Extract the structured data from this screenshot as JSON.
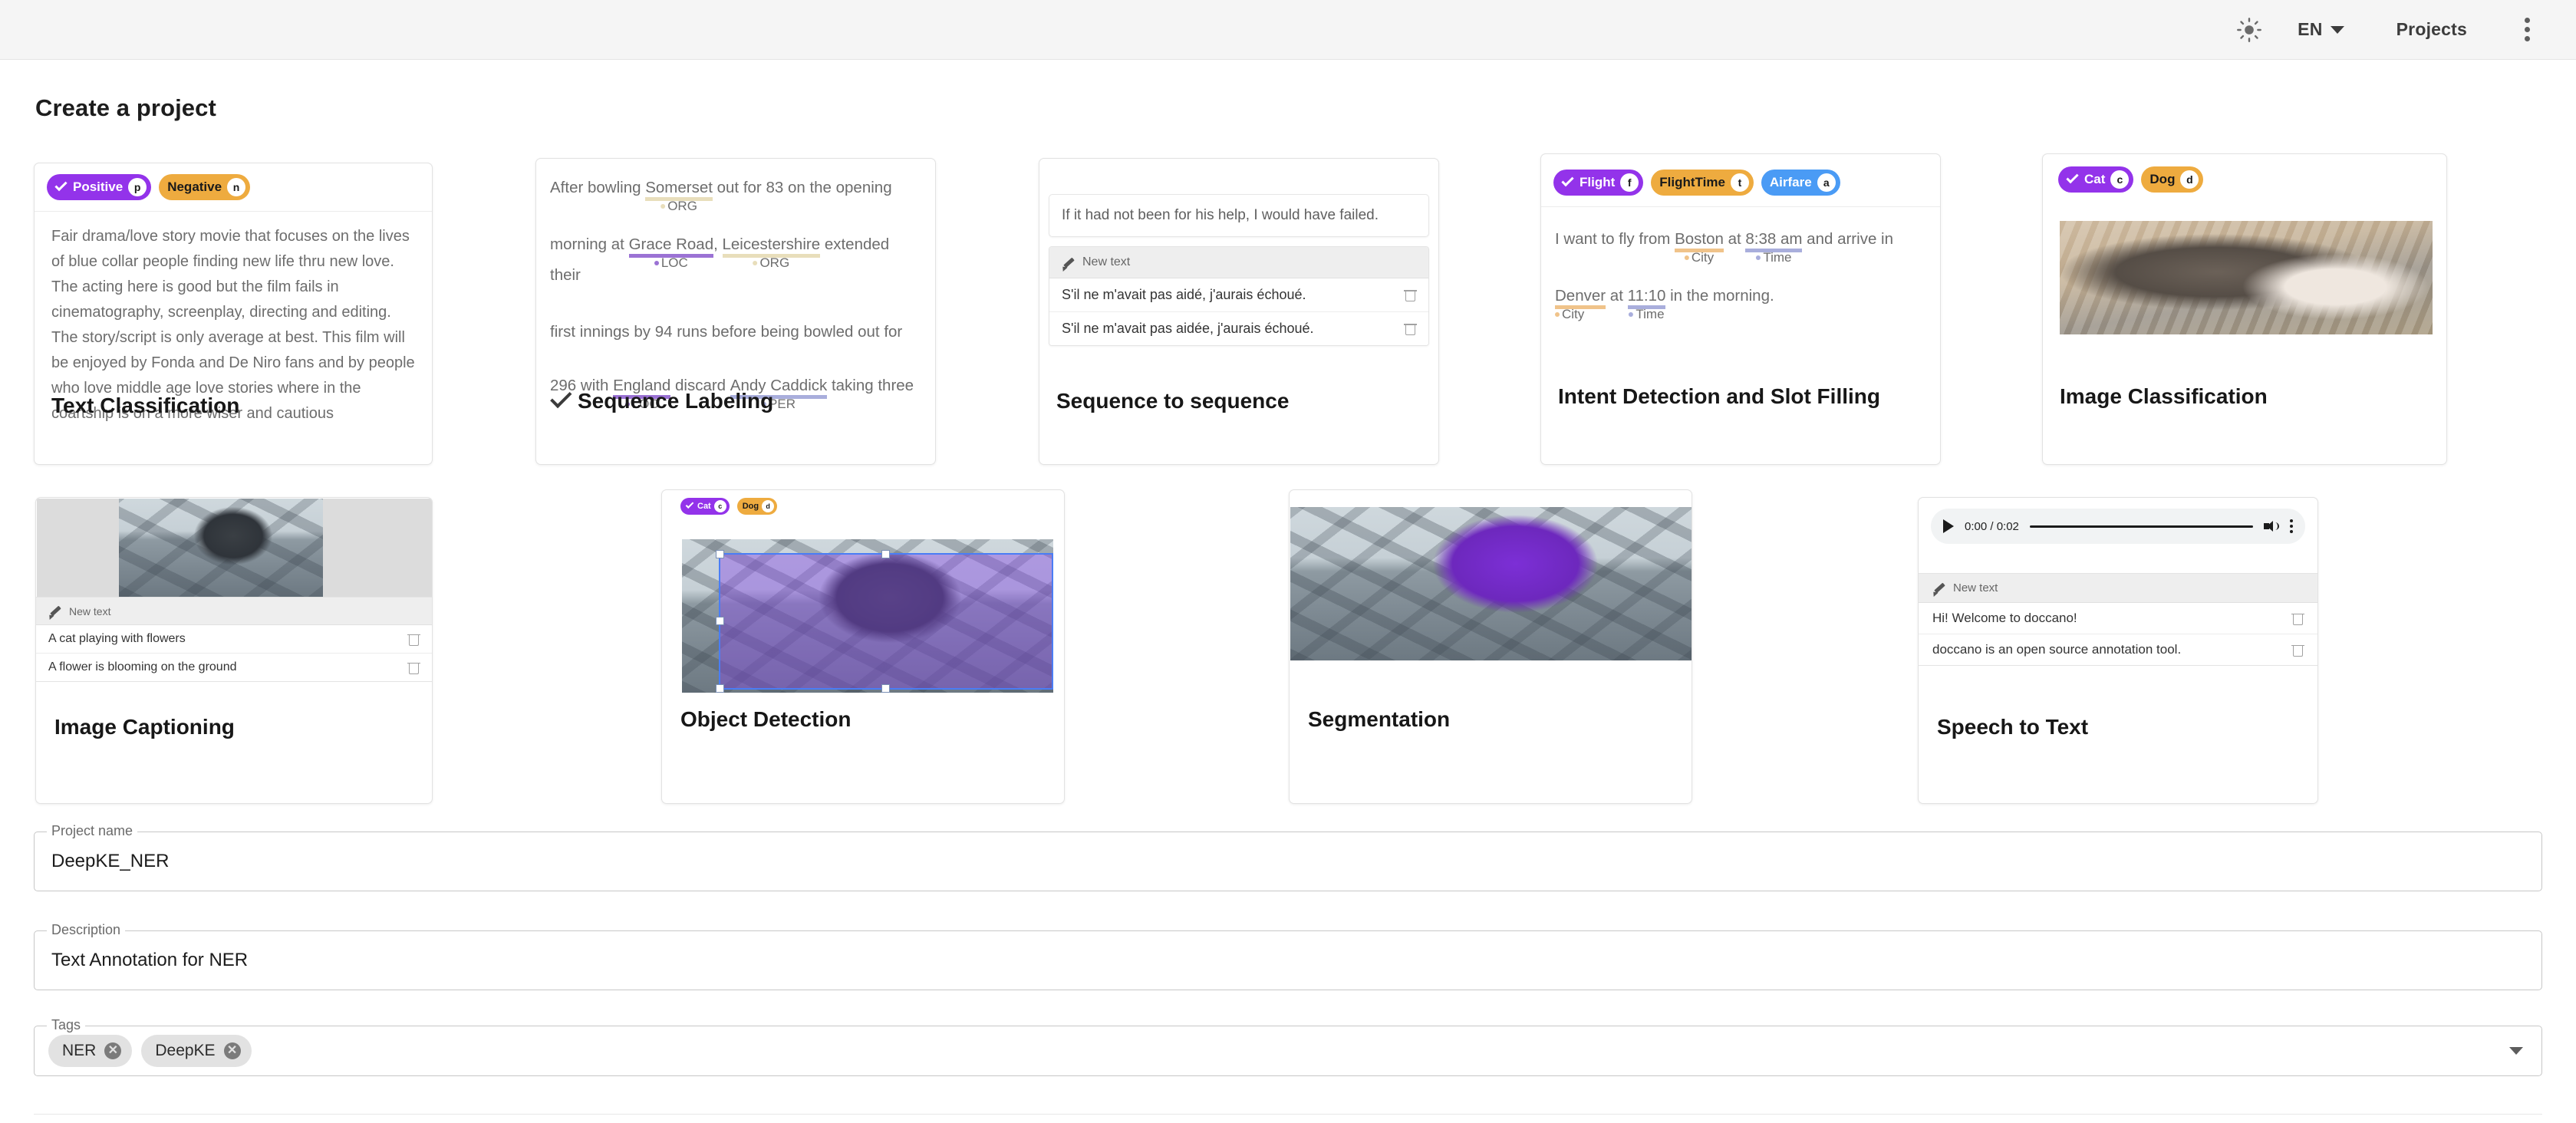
{
  "topbar": {
    "theme_icon": "sun-icon",
    "language": "EN",
    "projects_label": "Projects",
    "menu_icon": "kebab-menu-icon"
  },
  "page": {
    "title": "Create a project"
  },
  "project_types": [
    {
      "id": "text-classification",
      "title": "Text Classification",
      "selected": false,
      "labels": [
        {
          "text": "Positive",
          "key": "p",
          "color": "#9333ea",
          "checked": true
        },
        {
          "text": "Negative",
          "key": "n",
          "color": "#eeab3f",
          "checked": false
        }
      ],
      "body": "Fair drama/love story movie that focuses on the lives of blue collar people finding new life thru new love. The acting here is good but the film fails in cinematography, screenplay, directing and editing. The story/script is only average at best. This film will be enjoyed by Fonda and De Niro fans and by people who love middle age love stories where in the coartship is on a more wiser and cautious"
    },
    {
      "id": "sequence-labeling",
      "title": "Sequence Labeling",
      "selected": true,
      "lines": [
        {
          "pre": "After bowling ",
          "entity": "Somerset",
          "tag": "ORG",
          "color": "#e8debb",
          "post": " out for 83 on the opening"
        },
        {
          "pre": "morning at ",
          "entity": "Grace Road",
          "tag": "LOC",
          "color": "#9b72d4",
          "mid": ", ",
          "entity2": "Leicestershire",
          "tag2": "ORG",
          "color2": "#e8debb",
          "post": " extended their"
        },
        {
          "pre": "first innings by 94 runs before being bowled out for",
          "entity": "",
          "tag": "",
          "post": ""
        },
        {
          "pre": "296 with ",
          "entity": "England",
          "tag": "LOC",
          "color": "#9b72d4",
          "mid": " discard ",
          "entity2": "Andy Caddick",
          "tag2": "PER",
          "color2": "#a9aedc",
          "post": " taking three"
        }
      ]
    },
    {
      "id": "sequence-to-sequence",
      "title": "Sequence to sequence",
      "selected": false,
      "source": "If it had not been for his help, I would have failed.",
      "new_text_label": "New text",
      "annotations": [
        "S'il ne m'avait pas aidé, j'aurais échoué.",
        "S'il ne m'avait pas aidée, j'aurais échoué."
      ]
    },
    {
      "id": "intent-detection-and-slot-filling",
      "title": "Intent Detection and Slot Filling",
      "selected": false,
      "labels": [
        {
          "text": "Flight",
          "key": "f",
          "color": "#9333ea",
          "checked": true
        },
        {
          "text": "FlightTime",
          "key": "t",
          "color": "#eeab3f",
          "checked": false
        },
        {
          "text": "Airfare",
          "key": "a",
          "color": "#4a9bf5",
          "checked": false
        }
      ],
      "lines": [
        {
          "pre": "I want to fly from ",
          "entity": "Boston",
          "tag": "City",
          "color": "#f0c38a",
          "mid": " at ",
          "entity2": "8:38 am",
          "tag2": "Time",
          "color2": "#a9aedc",
          "post": " and arrive in"
        },
        {
          "pre": "",
          "entity": "Denver",
          "tag": "City",
          "color": "#f0c38a",
          "mid": " at ",
          "entity2": "11:10",
          "tag2": "Time",
          "color2": "#a9aedc",
          "post": " in the morning."
        }
      ]
    },
    {
      "id": "image-classification",
      "title": "Image Classification",
      "selected": false,
      "labels": [
        {
          "text": "Cat",
          "key": "c",
          "color": "#9333ea",
          "checked": true
        },
        {
          "text": "Dog",
          "key": "d",
          "color": "#eeab3f",
          "checked": false
        }
      ],
      "image_alt": "tabby-cat-photo"
    },
    {
      "id": "image-captioning",
      "title": "Image Captioning",
      "selected": false,
      "image_alt": "kitten-with-flower-photo",
      "new_text_label": "New text",
      "annotations": [
        "A cat playing with flowers",
        "A flower is blooming on the ground"
      ]
    },
    {
      "id": "object-detection",
      "title": "Object Detection",
      "selected": false,
      "labels": [
        {
          "text": "Cat",
          "key": "c",
          "color": "#9333ea",
          "checked": true
        },
        {
          "text": "Dog",
          "key": "d",
          "color": "#eeab3f",
          "checked": false
        }
      ],
      "image_alt": "kitten-with-bounding-box"
    },
    {
      "id": "segmentation",
      "title": "Segmentation",
      "selected": false,
      "image_alt": "kitten-segmentation-mask"
    },
    {
      "id": "speech-to-text",
      "title": "Speech to Text",
      "selected": false,
      "audio": {
        "current_time": "0:00",
        "duration": "0:02",
        "time_display": "0:00 / 0:02"
      },
      "new_text_label": "New text",
      "annotations": [
        "Hi! Welcome to doccano!",
        "doccano is an open source annotation tool."
      ]
    }
  ],
  "form": {
    "project_name": {
      "label": "Project name",
      "value": "DeepKE_NER"
    },
    "description": {
      "label": "Description",
      "value": "Text Annotation for NER"
    },
    "tags": {
      "label": "Tags",
      "chips": [
        "NER",
        "DeepKE"
      ]
    }
  }
}
